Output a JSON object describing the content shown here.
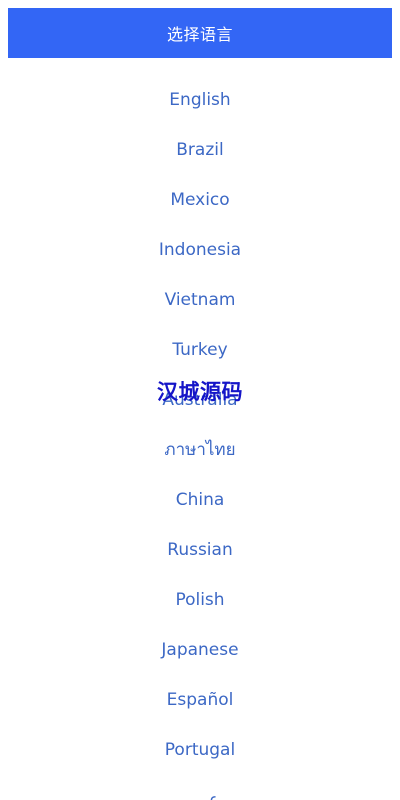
{
  "header": {
    "title": "选择语言",
    "background_color": "#3366f5"
  },
  "languages": [
    {
      "label": "English"
    },
    {
      "label": "Brazil"
    },
    {
      "label": "Mexico"
    },
    {
      "label": "Indonesia"
    },
    {
      "label": "Vietnam"
    },
    {
      "label": "Turkey"
    },
    {
      "label": "Australia"
    },
    {
      "label": "ภาษาไทย"
    },
    {
      "label": "China"
    },
    {
      "label": "Russian"
    },
    {
      "label": "Polish"
    },
    {
      "label": "Japanese"
    },
    {
      "label": "Español"
    },
    {
      "label": "Portugal"
    },
    {
      "label": "عربي"
    }
  ],
  "watermark": {
    "text": "汉城源码"
  },
  "colors": {
    "link": "#3c68c5",
    "watermark": "#1515c8"
  }
}
